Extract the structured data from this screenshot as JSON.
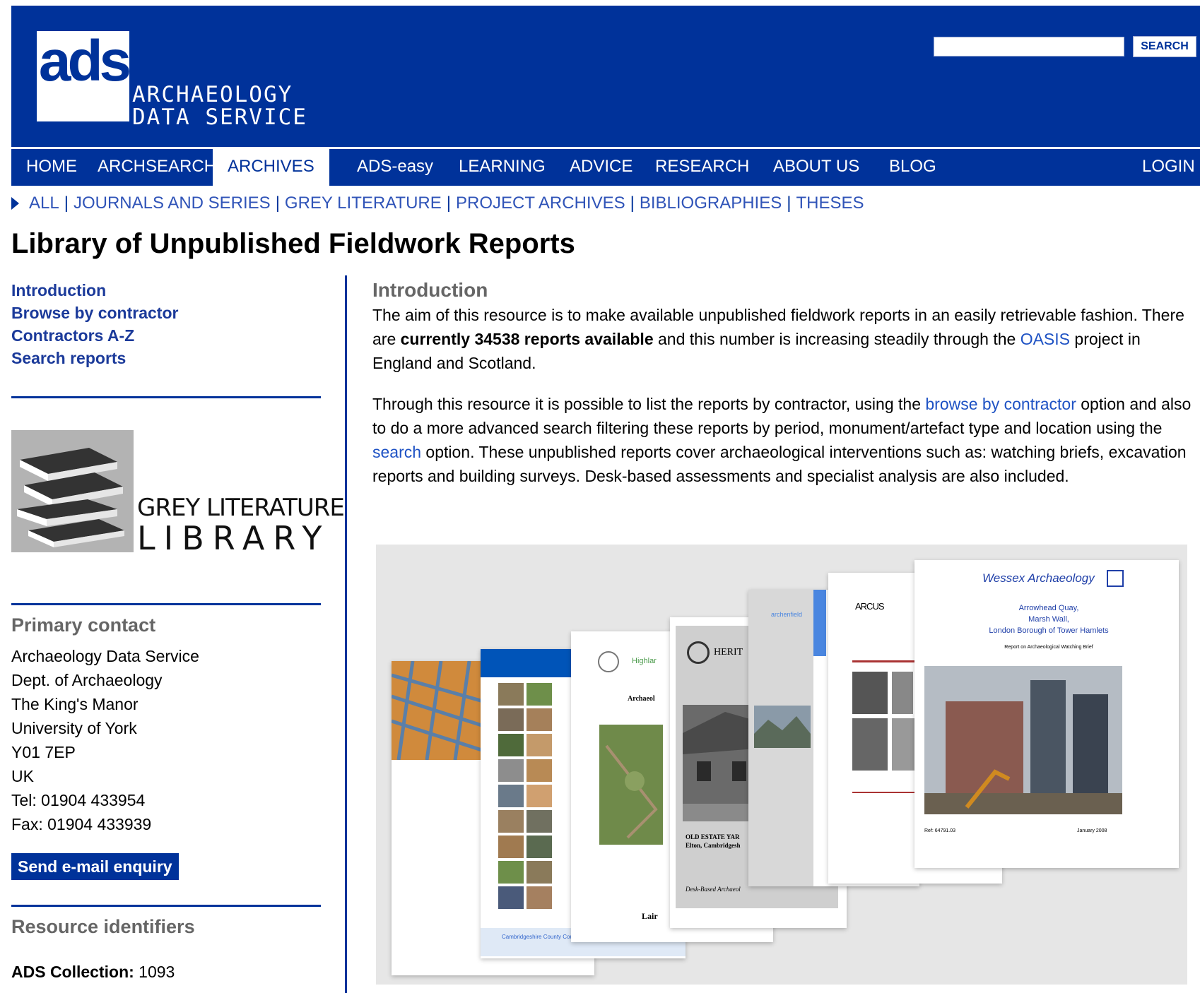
{
  "header": {
    "logo_mark": "ads",
    "logo_line1": "ARCHAEOLOGY",
    "logo_line2": "DATA SERVICE",
    "search_placeholder": "",
    "search_button": "SEARCH"
  },
  "nav": {
    "items": [
      "HOME",
      "ARCHSEARCH",
      "ARCHIVES",
      "ADS-easy",
      "LEARNING",
      "ADVICE",
      "RESEARCH",
      "ABOUT US",
      "BLOG"
    ],
    "active": "ARCHIVES",
    "login": "LOGIN"
  },
  "subnav": [
    "ALL",
    "JOURNALS AND SERIES",
    "GREY LITERATURE",
    "PROJECT ARCHIVES",
    "BIBLIOGRAPHIES",
    "THESES"
  ],
  "page_title": "Library of Unpublished Fieldwork Reports",
  "sidebar": {
    "links": [
      "Introduction",
      "Browse by contractor",
      "Contractors A-Z",
      "Search reports"
    ],
    "logo_line1": "GREY LITERATURE",
    "logo_line2": "LIBRARY",
    "primary_contact_heading": "Primary contact",
    "contact": [
      "Archaeology Data Service",
      "Dept. of Archaeology",
      "The King's Manor",
      "University of York",
      "Y01 7EP",
      "UK",
      "Tel: 01904 433954",
      "Fax: 01904 433939"
    ],
    "email_button": "Send e-mail enquiry",
    "identifiers_heading": "Resource identifiers",
    "collection_label": "ADS Collection:",
    "collection_value": "1093"
  },
  "main": {
    "heading": "Introduction",
    "p1_a": "The aim of this resource is to make available unpublished fieldwork reports in an easily retrievable fashion. There are ",
    "p1_bold": "currently 34538 reports available",
    "p1_b": " and this number is increasing steadily through the ",
    "p1_link": "OASIS",
    "p1_c": " project in England and Scotland.",
    "p2_a": "Through this resource it is possible to list the reports by contractor, using the ",
    "p2_link1": "browse by contractor",
    "p2_b": " option and also to do a more advanced search filtering these reports by period, monument/artefact type and location using the ",
    "p2_link2": "search",
    "p2_c": " option. These unpublished reports cover archaeological interventions such as: watching briefs, excavation reports and building surveys. Desk-based assessments and specialist analysis are also included."
  },
  "collage": {
    "wessex_title": "Wessex Archaeology",
    "wessex_address": [
      "Arrowhead Quay,",
      "Marsh Wall,",
      "London Borough of Tower Hamlets"
    ],
    "wessex_subtitle": "Report on Archaeological Watching Brief",
    "wessex_ref": "Ref: 64791.03",
    "wessex_date": "January 2008",
    "arcus": "ARCUS",
    "archenfield": "archenfield",
    "heritage": "HERIT",
    "heritage_estate": "OLD ESTATE YAR",
    "heritage_place": "Elton, Cambridgesh",
    "heritage_desk": "Desk-Based Archaeol",
    "highland": "Highlar",
    "highland_archaeol": "Archaeol",
    "highland_lair": "Lair",
    "cambs": "Cambridgeshire County Council"
  }
}
